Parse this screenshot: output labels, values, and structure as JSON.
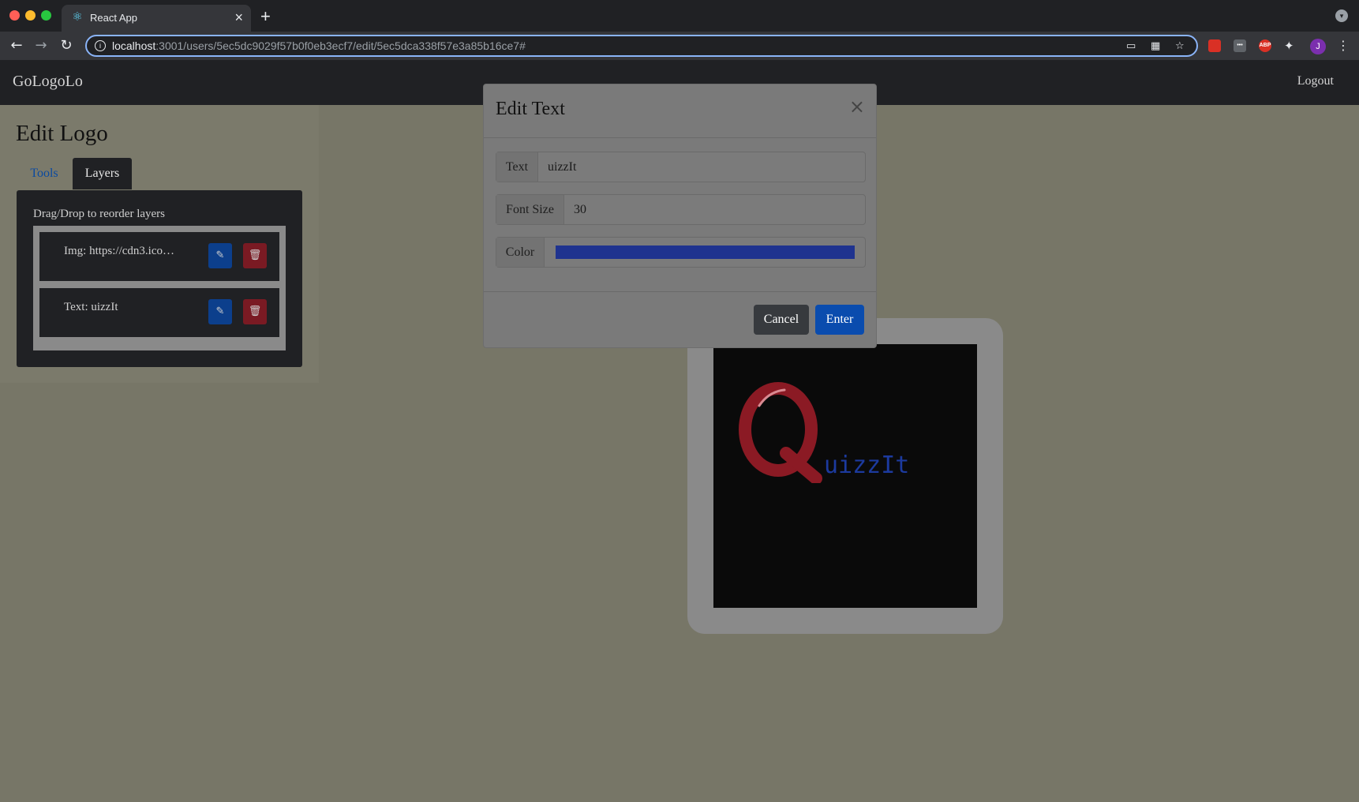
{
  "browser": {
    "tab_title": "React App",
    "url_host": "localhost",
    "url_rest": ":3001/users/5ec5dc9029f57b0f0eb3ecf7/edit/5ec5dca338f57e3a85b16ce7#",
    "profile_initial": "J",
    "ext_abp": "ABP"
  },
  "app": {
    "brand": "GoLogoLo",
    "logout": "Logout"
  },
  "side": {
    "title": "Edit Logo",
    "tabs": [
      {
        "label": "Tools",
        "active": false
      },
      {
        "label": "Layers",
        "active": true
      }
    ],
    "hint": "Drag/Drop to reorder layers",
    "layers": [
      {
        "label": "Img: https://cdn3.ico…"
      },
      {
        "label": "Text: uizzIt"
      }
    ]
  },
  "canvas": {
    "logo_text": "uizzIt",
    "text_color": "#1c3a9e",
    "background": "#0a0a0a"
  },
  "modal": {
    "title": "Edit Text",
    "close": "×",
    "fields": {
      "text_label": "Text",
      "text_value": "uizzIt",
      "font_size_label": "Font Size",
      "font_size_value": "30",
      "color_label": "Color",
      "color_value": "#2343e0"
    },
    "cancel": "Cancel",
    "enter": "Enter"
  }
}
